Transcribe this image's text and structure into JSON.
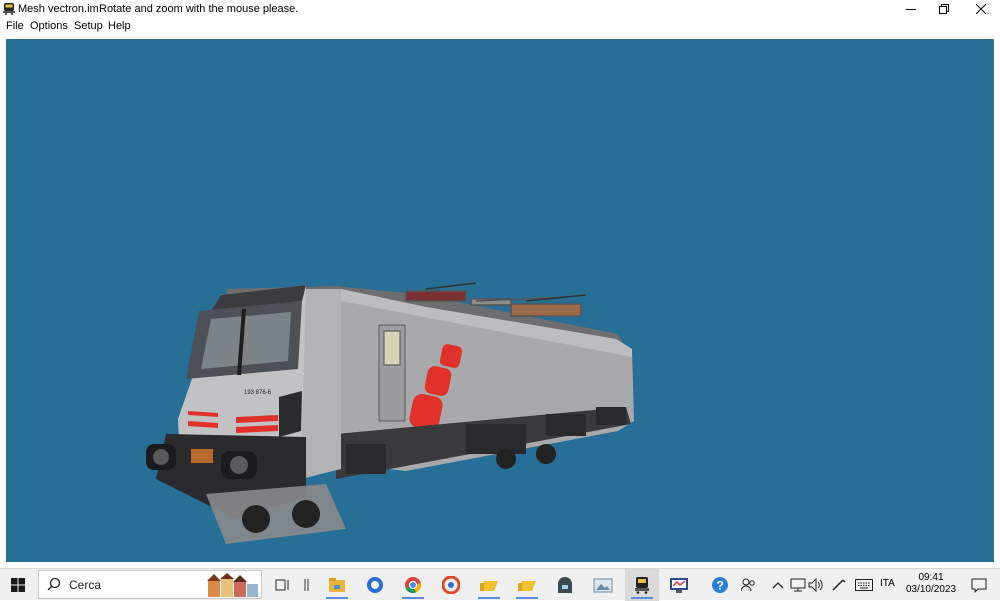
{
  "window": {
    "file_name": "Mesh vectron.im",
    "hint": "Rotate and zoom with the mouse please.",
    "controls": [
      "minimize-icon",
      "restore-icon",
      "close-icon"
    ]
  },
  "menu": {
    "items": [
      {
        "label": "File"
      },
      {
        "label": "Options"
      },
      {
        "label": "Setup"
      },
      {
        "label": "Help"
      }
    ]
  },
  "viewport": {
    "background_color": "#276f96",
    "model": {
      "locomotive_number": "193 876-6",
      "body_color": "#a9a9ab",
      "accent_color": "#e0322b"
    }
  },
  "taskbar": {
    "search_placeholder": "Cerca",
    "apps": [
      "windows-start-icon",
      "search-icon",
      "task-view-icon",
      "file-explorer-icon",
      "browser-icon",
      "chrome-icon",
      "app-icon",
      "folder-icon",
      "folder-icon",
      "app-icon",
      "photos-icon",
      "mesh-viewer-icon",
      "monitor-app-icon"
    ],
    "tray": {
      "language": "ITA",
      "time": "09:41",
      "date": "03/10/2023"
    }
  }
}
